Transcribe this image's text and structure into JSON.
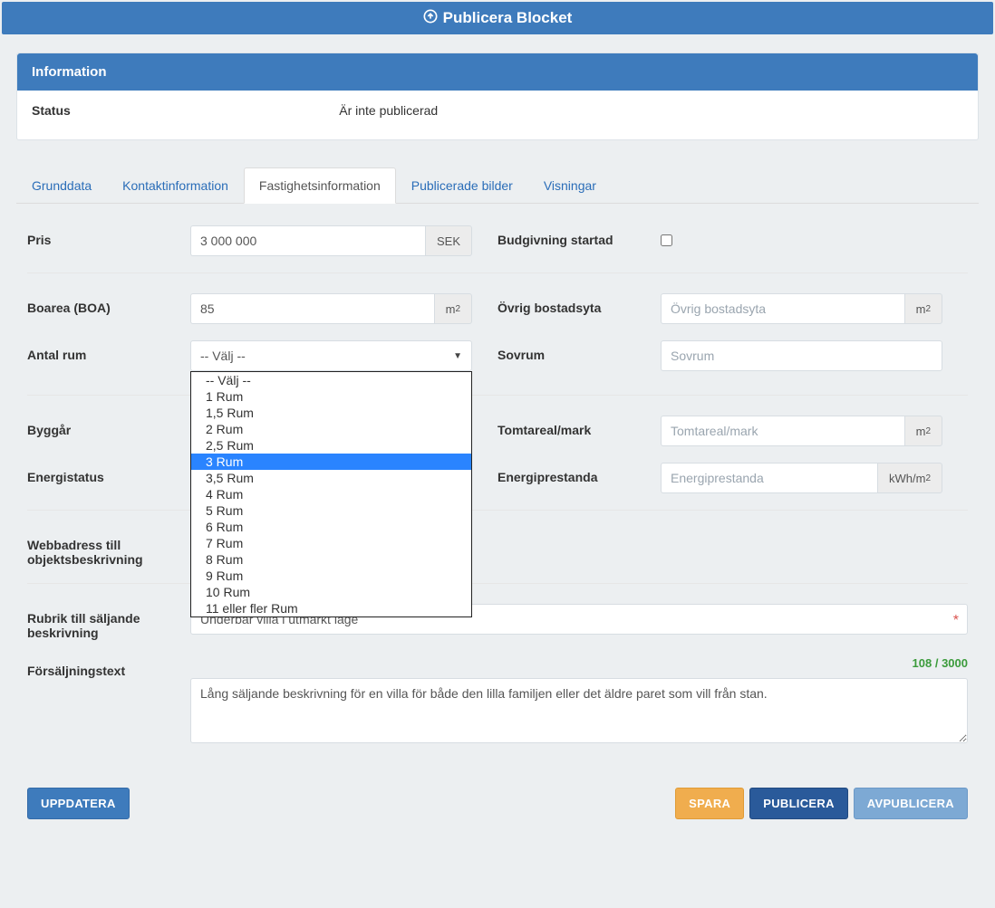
{
  "header": {
    "title": "Publicera Blocket"
  },
  "info": {
    "panel_title": "Information",
    "status_label": "Status",
    "status_value": "Är inte publicerad"
  },
  "tabs": {
    "t0": "Grunddata",
    "t1": "Kontaktinformation",
    "t2": "Fastighetsinformation",
    "t3": "Publicerade bilder",
    "t4": "Visningar"
  },
  "form": {
    "pris_label": "Pris",
    "pris_value": "3 000 000",
    "pris_unit": "SEK",
    "budgivning_label": "Budgivning startad",
    "boarea_label": "Boarea (BOA)",
    "boarea_value": "85",
    "m2": "m",
    "ovrig_label": "Övrig bostadsyta",
    "ovrig_placeholder": "Övrig bostadsyta",
    "antal_label": "Antal rum",
    "antal_display": "-- Välj --",
    "sovrum_label": "Sovrum",
    "sovrum_placeholder": "Sovrum",
    "byggar_label": "Byggår",
    "tomt_label": "Tomtareal/mark",
    "tomt_placeholder": "Tomtareal/mark",
    "energi_label": "Energistatus",
    "energip_label": "Energiprestanda",
    "energip_placeholder": "Energiprestanda",
    "kwh": "kWh/m",
    "webb_label": "Webbadress till objektsbeskrivning",
    "rubrik_label": "Rubrik till säljande beskrivning",
    "rubrik_value": "Underbar villa i utmärkt läge",
    "text_label": "Försäljningstext",
    "text_counter": "108 / 3000",
    "text_value": "Lång säljande beskrivning för en villa för både den lilla familjen eller det äldre paret som vill från stan."
  },
  "rooms": {
    "o0": "-- Välj --",
    "o1": "1 Rum",
    "o2": "1,5 Rum",
    "o3": "2 Rum",
    "o4": "2,5 Rum",
    "o5": "3 Rum",
    "o6": "3,5 Rum",
    "o7": "4 Rum",
    "o8": "5 Rum",
    "o9": "6 Rum",
    "o10": "7 Rum",
    "o11": "8 Rum",
    "o12": "9 Rum",
    "o13": "10 Rum",
    "o14": "11 eller fler Rum"
  },
  "buttons": {
    "update": "UPPDATERA",
    "save": "SPARA",
    "publish": "PUBLICERA",
    "unpublish": "AVPUBLICERA"
  }
}
